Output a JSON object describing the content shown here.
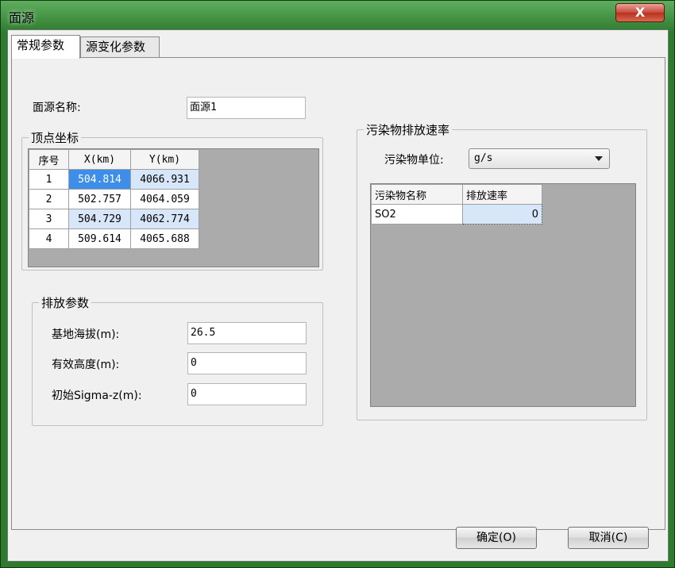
{
  "window": {
    "title": "面源",
    "close_label": "X"
  },
  "tabs": [
    {
      "label": "常规参数",
      "active": true
    },
    {
      "label": "源变化参数",
      "active": false
    }
  ],
  "source_name": {
    "label": "面源名称:",
    "value": "面源1"
  },
  "vertex_group": {
    "title": "顶点坐标",
    "columns": [
      "序号",
      "X(km)",
      "Y(km)"
    ],
    "rows": [
      {
        "no": "1",
        "x": "504.814",
        "y": "4066.931"
      },
      {
        "no": "2",
        "x": "502.757",
        "y": "4064.059"
      },
      {
        "no": "3",
        "x": "504.729",
        "y": "4062.774"
      },
      {
        "no": "4",
        "x": "509.614",
        "y": "4065.688"
      }
    ]
  },
  "emission_group": {
    "title": "排放参数",
    "fields": [
      {
        "label": "基地海拔(m):",
        "value": "26.5"
      },
      {
        "label": "有效高度(m):",
        "value": "0"
      },
      {
        "label": "初始Sigma-z(m):",
        "value": "0"
      }
    ]
  },
  "pollutant_group": {
    "title": "污染物排放速率",
    "unit_label": "污染物单位:",
    "unit_value": "g/s",
    "columns": [
      "污染物名称",
      "排放速率"
    ],
    "rows": [
      {
        "name": "SO2",
        "rate": "0"
      }
    ]
  },
  "buttons": {
    "ok": "确定(O)",
    "cancel": "取消(C)"
  },
  "colors": {
    "title_bar": "#2e7a2e",
    "selection": "#3c8ee8",
    "close_button": "#c9473a"
  },
  "icons": {
    "close": "close-icon",
    "dropdown": "chevron-down-icon"
  }
}
